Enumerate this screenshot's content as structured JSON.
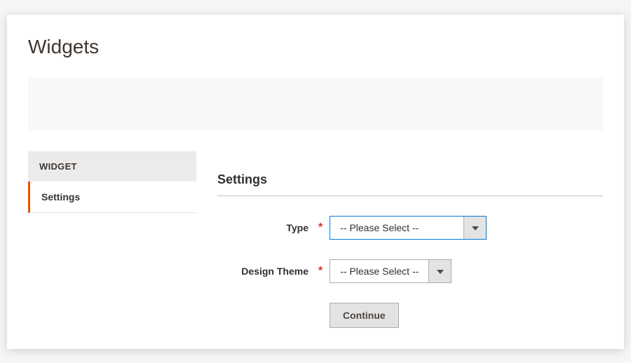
{
  "page": {
    "title": "Widgets"
  },
  "sidebar": {
    "header": "WIDGET",
    "items": [
      {
        "label": "Settings",
        "active": true
      }
    ]
  },
  "form": {
    "section_title": "Settings",
    "fields": {
      "type": {
        "label": "Type",
        "required": "*",
        "selected": "-- Please Select --"
      },
      "design_theme": {
        "label": "Design Theme",
        "required": "*",
        "selected": "-- Please Select --"
      }
    },
    "continue_button": "Continue"
  }
}
